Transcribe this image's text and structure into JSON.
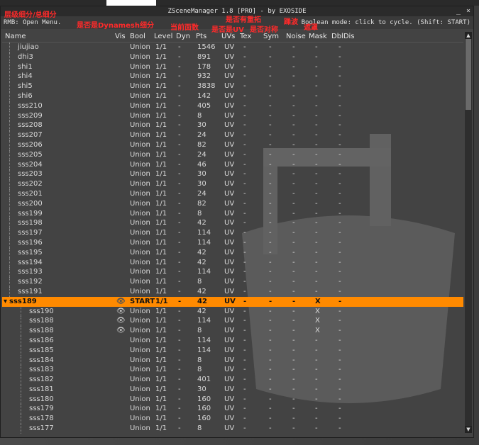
{
  "window": {
    "title": "ZSceneManager 1.8 [PRO]  -  by EXOSIDE",
    "minimize": "_",
    "close": "×",
    "hint_left": "RMB: Open Menu.",
    "hint_right": "Boolean mode: click to cycle. (Shift: START)"
  },
  "annotations": {
    "a1": "层级细分/总细分",
    "a2": "是否是Dynamesh细分",
    "a3": "当前面数",
    "a4": "是否有重拓",
    "a5": "是否是UV",
    "a6": "是否对称",
    "a7": "躁波",
    "a8": "遮罩"
  },
  "headers": [
    "Name",
    "Vis",
    "Bool",
    "Level",
    "Dyn",
    "Pts",
    "UVs",
    "Tex",
    "Sym",
    "Noise",
    "Mask",
    "DblDis"
  ],
  "rows": [
    {
      "name": "jiujiao",
      "vis": "",
      "bool": "Union",
      "level": "1/1",
      "dyn": "-",
      "pts": "1546",
      "uvs": "UV",
      "tex": "-",
      "sym": "-",
      "noise": "-",
      "mask": "-",
      "dbl": "-",
      "indent": 1
    },
    {
      "name": "dhi3",
      "vis": "",
      "bool": "Union",
      "level": "1/1",
      "dyn": "-",
      "pts": "891",
      "uvs": "UV",
      "tex": "-",
      "sym": "-",
      "noise": "-",
      "mask": "-",
      "dbl": "-",
      "indent": 1
    },
    {
      "name": "shi1",
      "vis": "",
      "bool": "Union",
      "level": "1/1",
      "dyn": "-",
      "pts": "178",
      "uvs": "UV",
      "tex": "-",
      "sym": "-",
      "noise": "-",
      "mask": "-",
      "dbl": "-",
      "indent": 1
    },
    {
      "name": "shi4",
      "vis": "",
      "bool": "Union",
      "level": "1/1",
      "dyn": "-",
      "pts": "932",
      "uvs": "UV",
      "tex": "-",
      "sym": "-",
      "noise": "-",
      "mask": "-",
      "dbl": "-",
      "indent": 1
    },
    {
      "name": "shi5",
      "vis": "",
      "bool": "Union",
      "level": "1/1",
      "dyn": "-",
      "pts": "3838",
      "uvs": "UV",
      "tex": "-",
      "sym": "-",
      "noise": "-",
      "mask": "-",
      "dbl": "-",
      "indent": 1
    },
    {
      "name": "shi6",
      "vis": "",
      "bool": "Union",
      "level": "1/1",
      "dyn": "-",
      "pts": "142",
      "uvs": "UV",
      "tex": "-",
      "sym": "-",
      "noise": "-",
      "mask": "-",
      "dbl": "-",
      "indent": 1
    },
    {
      "name": "sss210",
      "vis": "",
      "bool": "Union",
      "level": "1/1",
      "dyn": "-",
      "pts": "405",
      "uvs": "UV",
      "tex": "-",
      "sym": "-",
      "noise": "-",
      "mask": "-",
      "dbl": "-",
      "indent": 1
    },
    {
      "name": "sss209",
      "vis": "",
      "bool": "Union",
      "level": "1/1",
      "dyn": "-",
      "pts": "8",
      "uvs": "UV",
      "tex": "-",
      "sym": "-",
      "noise": "-",
      "mask": "-",
      "dbl": "-",
      "indent": 1
    },
    {
      "name": "sss208",
      "vis": "",
      "bool": "Union",
      "level": "1/1",
      "dyn": "-",
      "pts": "30",
      "uvs": "UV",
      "tex": "-",
      "sym": "-",
      "noise": "-",
      "mask": "-",
      "dbl": "-",
      "indent": 1
    },
    {
      "name": "sss207",
      "vis": "",
      "bool": "Union",
      "level": "1/1",
      "dyn": "-",
      "pts": "24",
      "uvs": "UV",
      "tex": "-",
      "sym": "-",
      "noise": "-",
      "mask": "-",
      "dbl": "-",
      "indent": 1
    },
    {
      "name": "sss206",
      "vis": "",
      "bool": "Union",
      "level": "1/1",
      "dyn": "-",
      "pts": "82",
      "uvs": "UV",
      "tex": "-",
      "sym": "-",
      "noise": "-",
      "mask": "-",
      "dbl": "-",
      "indent": 1
    },
    {
      "name": "sss205",
      "vis": "",
      "bool": "Union",
      "level": "1/1",
      "dyn": "-",
      "pts": "24",
      "uvs": "UV",
      "tex": "-",
      "sym": "-",
      "noise": "-",
      "mask": "-",
      "dbl": "-",
      "indent": 1
    },
    {
      "name": "sss204",
      "vis": "",
      "bool": "Union",
      "level": "1/1",
      "dyn": "-",
      "pts": "46",
      "uvs": "UV",
      "tex": "-",
      "sym": "-",
      "noise": "-",
      "mask": "-",
      "dbl": "-",
      "indent": 1
    },
    {
      "name": "sss203",
      "vis": "",
      "bool": "Union",
      "level": "1/1",
      "dyn": "-",
      "pts": "30",
      "uvs": "UV",
      "tex": "-",
      "sym": "-",
      "noise": "-",
      "mask": "-",
      "dbl": "-",
      "indent": 1
    },
    {
      "name": "sss202",
      "vis": "",
      "bool": "Union",
      "level": "1/1",
      "dyn": "-",
      "pts": "30",
      "uvs": "UV",
      "tex": "-",
      "sym": "-",
      "noise": "-",
      "mask": "-",
      "dbl": "-",
      "indent": 1
    },
    {
      "name": "sss201",
      "vis": "",
      "bool": "Union",
      "level": "1/1",
      "dyn": "-",
      "pts": "24",
      "uvs": "UV",
      "tex": "-",
      "sym": "-",
      "noise": "-",
      "mask": "-",
      "dbl": "-",
      "indent": 1
    },
    {
      "name": "sss200",
      "vis": "",
      "bool": "Union",
      "level": "1/1",
      "dyn": "-",
      "pts": "82",
      "uvs": "UV",
      "tex": "-",
      "sym": "-",
      "noise": "-",
      "mask": "-",
      "dbl": "-",
      "indent": 1
    },
    {
      "name": "sss199",
      "vis": "",
      "bool": "Union",
      "level": "1/1",
      "dyn": "-",
      "pts": "8",
      "uvs": "UV",
      "tex": "-",
      "sym": "-",
      "noise": "-",
      "mask": "-",
      "dbl": "-",
      "indent": 1
    },
    {
      "name": "sss198",
      "vis": "",
      "bool": "Union",
      "level": "1/1",
      "dyn": "-",
      "pts": "42",
      "uvs": "UV",
      "tex": "-",
      "sym": "-",
      "noise": "-",
      "mask": "-",
      "dbl": "-",
      "indent": 1
    },
    {
      "name": "sss197",
      "vis": "",
      "bool": "Union",
      "level": "1/1",
      "dyn": "-",
      "pts": "114",
      "uvs": "UV",
      "tex": "-",
      "sym": "-",
      "noise": "-",
      "mask": "-",
      "dbl": "-",
      "indent": 1
    },
    {
      "name": "sss196",
      "vis": "",
      "bool": "Union",
      "level": "1/1",
      "dyn": "-",
      "pts": "114",
      "uvs": "UV",
      "tex": "-",
      "sym": "-",
      "noise": "-",
      "mask": "-",
      "dbl": "-",
      "indent": 1
    },
    {
      "name": "sss195",
      "vis": "",
      "bool": "Union",
      "level": "1/1",
      "dyn": "-",
      "pts": "42",
      "uvs": "UV",
      "tex": "-",
      "sym": "-",
      "noise": "-",
      "mask": "-",
      "dbl": "-",
      "indent": 1
    },
    {
      "name": "sss194",
      "vis": "",
      "bool": "Union",
      "level": "1/1",
      "dyn": "-",
      "pts": "42",
      "uvs": "UV",
      "tex": "-",
      "sym": "-",
      "noise": "-",
      "mask": "-",
      "dbl": "-",
      "indent": 1
    },
    {
      "name": "sss193",
      "vis": "",
      "bool": "Union",
      "level": "1/1",
      "dyn": "-",
      "pts": "114",
      "uvs": "UV",
      "tex": "-",
      "sym": "-",
      "noise": "-",
      "mask": "-",
      "dbl": "-",
      "indent": 1
    },
    {
      "name": "sss192",
      "vis": "",
      "bool": "Union",
      "level": "1/1",
      "dyn": "-",
      "pts": "8",
      "uvs": "UV",
      "tex": "-",
      "sym": "-",
      "noise": "-",
      "mask": "-",
      "dbl": "-",
      "indent": 1
    },
    {
      "name": "sss191",
      "vis": "",
      "bool": "Union",
      "level": "1/1",
      "dyn": "-",
      "pts": "42",
      "uvs": "UV",
      "tex": "-",
      "sym": "-",
      "noise": "-",
      "mask": "-",
      "dbl": "-",
      "indent": 1
    },
    {
      "name": "sss189",
      "vis": "eye",
      "bool": "START",
      "level": "1/1",
      "dyn": "-",
      "pts": "42",
      "uvs": "UV",
      "tex": "-",
      "sym": "-",
      "noise": "-",
      "mask": "X",
      "dbl": "-",
      "indent": 0,
      "selected": true
    },
    {
      "name": "sss190",
      "vis": "eye",
      "bool": "Union",
      "level": "1/1",
      "dyn": "-",
      "pts": "42",
      "uvs": "UV",
      "tex": "-",
      "sym": "-",
      "noise": "-",
      "mask": "X",
      "dbl": "-",
      "indent": 2
    },
    {
      "name": "sss188",
      "vis": "eye",
      "bool": "Union",
      "level": "1/1",
      "dyn": "-",
      "pts": "114",
      "uvs": "UV",
      "tex": "-",
      "sym": "-",
      "noise": "-",
      "mask": "X",
      "dbl": "-",
      "indent": 2
    },
    {
      "name": "sss188",
      "vis": "eye",
      "bool": "Union",
      "level": "1/1",
      "dyn": "-",
      "pts": "8",
      "uvs": "UV",
      "tex": "-",
      "sym": "-",
      "noise": "-",
      "mask": "X",
      "dbl": "-",
      "indent": 2
    },
    {
      "name": "sss186",
      "vis": "",
      "bool": "Union",
      "level": "1/1",
      "dyn": "-",
      "pts": "114",
      "uvs": "UV",
      "tex": "-",
      "sym": "-",
      "noise": "-",
      "mask": "-",
      "dbl": "-",
      "indent": 2
    },
    {
      "name": "sss185",
      "vis": "",
      "bool": "Union",
      "level": "1/1",
      "dyn": "-",
      "pts": "114",
      "uvs": "UV",
      "tex": "-",
      "sym": "-",
      "noise": "-",
      "mask": "-",
      "dbl": "-",
      "indent": 2
    },
    {
      "name": "sss184",
      "vis": "",
      "bool": "Union",
      "level": "1/1",
      "dyn": "-",
      "pts": "8",
      "uvs": "UV",
      "tex": "-",
      "sym": "-",
      "noise": "-",
      "mask": "-",
      "dbl": "-",
      "indent": 2
    },
    {
      "name": "sss183",
      "vis": "",
      "bool": "Union",
      "level": "1/1",
      "dyn": "-",
      "pts": "8",
      "uvs": "UV",
      "tex": "-",
      "sym": "-",
      "noise": "-",
      "mask": "-",
      "dbl": "-",
      "indent": 2
    },
    {
      "name": "sss182",
      "vis": "",
      "bool": "Union",
      "level": "1/1",
      "dyn": "-",
      "pts": "401",
      "uvs": "UV",
      "tex": "-",
      "sym": "-",
      "noise": "-",
      "mask": "-",
      "dbl": "-",
      "indent": 2
    },
    {
      "name": "sss181",
      "vis": "",
      "bool": "Union",
      "level": "1/1",
      "dyn": "-",
      "pts": "30",
      "uvs": "UV",
      "tex": "-",
      "sym": "-",
      "noise": "-",
      "mask": "-",
      "dbl": "-",
      "indent": 2
    },
    {
      "name": "sss180",
      "vis": "",
      "bool": "Union",
      "level": "1/1",
      "dyn": "-",
      "pts": "160",
      "uvs": "UV",
      "tex": "-",
      "sym": "-",
      "noise": "-",
      "mask": "-",
      "dbl": "-",
      "indent": 2
    },
    {
      "name": "sss179",
      "vis": "",
      "bool": "Union",
      "level": "1/1",
      "dyn": "-",
      "pts": "160",
      "uvs": "UV",
      "tex": "-",
      "sym": "-",
      "noise": "-",
      "mask": "-",
      "dbl": "-",
      "indent": 2
    },
    {
      "name": "sss178",
      "vis": "",
      "bool": "Union",
      "level": "1/1",
      "dyn": "-",
      "pts": "160",
      "uvs": "UV",
      "tex": "-",
      "sym": "-",
      "noise": "-",
      "mask": "-",
      "dbl": "-",
      "indent": 2
    },
    {
      "name": "sss177",
      "vis": "",
      "bool": "Union",
      "level": "1/1",
      "dyn": "-",
      "pts": "8",
      "uvs": "UV",
      "tex": "-",
      "sym": "-",
      "noise": "-",
      "mask": "-",
      "dbl": "-",
      "indent": 2
    }
  ],
  "colors": {
    "selected_row": "#ff8a00",
    "annotation": "#ff2a2a"
  }
}
